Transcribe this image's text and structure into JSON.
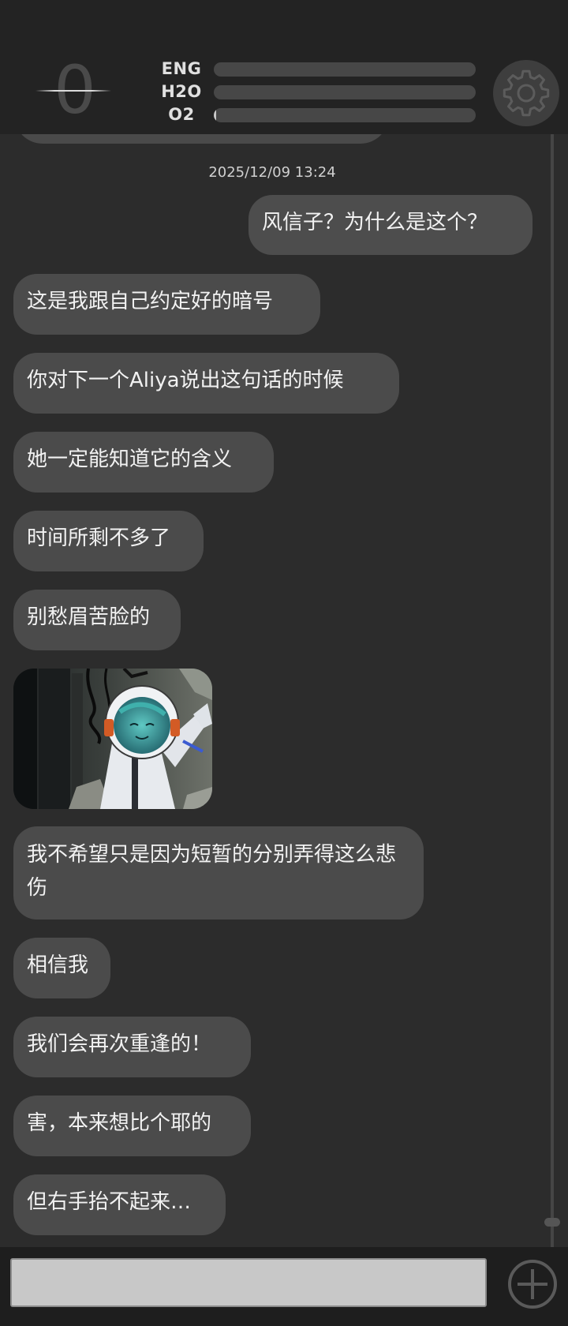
{
  "status": {
    "counter": "0",
    "bars": [
      {
        "label": "ENG",
        "level": 0
      },
      {
        "label": "H2O",
        "level": 0
      },
      {
        "label": "O2",
        "level": 0.01
      }
    ]
  },
  "chat": {
    "timestamp": "2025/12/09  13:24",
    "messages": [
      {
        "side": "outgoing",
        "text": "风信子？为什么是这个？"
      },
      {
        "side": "incoming",
        "text": "这是我跟自己约定好的暗号"
      },
      {
        "side": "incoming",
        "text": "你对下一个Aliya说出这句话的时候"
      },
      {
        "side": "incoming",
        "text": "她一定能知道它的含义"
      },
      {
        "side": "incoming",
        "text": "时间所剩不多了"
      },
      {
        "side": "incoming",
        "text": "别愁眉苦脸的"
      },
      {
        "side": "incoming",
        "text": "我不希望只是因为短暂的分别弄得这么悲伤"
      },
      {
        "side": "incoming",
        "text": "相信我"
      },
      {
        "side": "incoming",
        "text": "我们会再次重逢的！"
      },
      {
        "side": "incoming",
        "text": "害，本来想比个耶的"
      },
      {
        "side": "incoming",
        "text": "但右手抬不起来…"
      }
    ],
    "photo": {
      "description_icon": "astronaut-photo"
    }
  },
  "composer": {
    "input_value": "",
    "input_placeholder": ""
  },
  "icons": {
    "settings": "gear-icon",
    "add": "plus-circle-icon"
  },
  "colors": {
    "background": "#2c2c2c",
    "header": "#232323",
    "bubble": "#4b4b4b",
    "bar_track": "#474747",
    "bar_fill": "#c9c9c9",
    "input_bar": "#1e1e1e",
    "input_field": "#c8c8c8"
  }
}
